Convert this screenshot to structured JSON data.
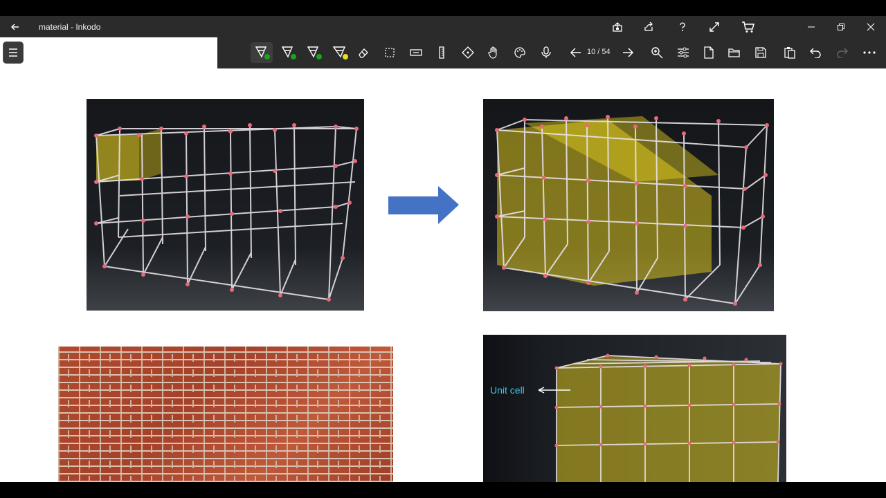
{
  "window": {
    "title": "material  - Inkodo"
  },
  "titlebar_icons": [
    "back-arrow-icon",
    "export-icon",
    "share-icon",
    "help-icon",
    "fullscreen-icon",
    "cart-icon",
    "minimize-icon",
    "restore-icon",
    "close-icon"
  ],
  "toolbar": {
    "page_indicator": "10 / 54",
    "pens": [
      {
        "name": "pen-1",
        "dot_color": "#1aa31a"
      },
      {
        "name": "pen-2",
        "dot_color": "#1aa31a"
      },
      {
        "name": "pen-3",
        "dot_color": "#1aa31a"
      },
      {
        "name": "highlighter",
        "dot_color": "#e8e020"
      }
    ],
    "tools": [
      "eraser-icon",
      "lasso-select-icon",
      "text-tool-icon",
      "ruler-icon",
      "pan-icon",
      "hand-icon",
      "palette-icon",
      "microphone-icon",
      "prev-page-icon",
      "next-page-icon",
      "zoom-icon",
      "settings-sliders-icon",
      "new-page-icon",
      "open-folder-icon",
      "save-icon",
      "paste-icon",
      "undo-icon",
      "redo-icon",
      "more-icon"
    ]
  },
  "slide": {
    "unit_cell_label": "Unit cell",
    "colors": {
      "arrow": "#4472c4",
      "lattice_line": "#e8e2e8",
      "node": "#e86a7a",
      "fill": "#e6d21e",
      "label": "#38c8e8"
    }
  }
}
